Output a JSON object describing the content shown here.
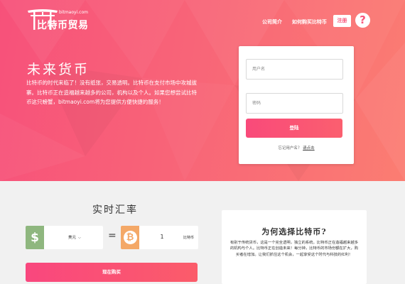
{
  "header": {
    "logo_domain": "bitmaoyi.com",
    "logo_title": "比特币贸易",
    "nav": {
      "about": "公司简介",
      "how_to_buy": "如何购买比特币"
    },
    "register_label": "注册",
    "help_glyph": "?"
  },
  "hero": {
    "heading": "未来货币",
    "text": "比特币的时代来临了！没有纸张，交易透明。比特币在支付市场中攻城拔寨。比特币正在造福越来越多的公司，机构以及个人。如果您想尝试比特币这只螃蟹，bitmaoyi.com将为您提供方便快捷的服务！"
  },
  "login": {
    "username_placeholder": "用户名",
    "password_placeholder": "密码",
    "submit_label": "登陆",
    "forgot_text": "忘记用户名？",
    "forgot_link": "请点击"
  },
  "converter": {
    "title": "实时汇率",
    "usd_glyph": "$",
    "currency_selected": "美元",
    "equals": "=",
    "btc_glyph": "₿",
    "btc_amount": "1",
    "btc_unit": "比特币",
    "buy_label": "现在购买"
  },
  "why": {
    "title": "为何选择比特币?",
    "text": "有别于传统货币，这是一个完全透明，独立的系统。比特币正在造福越来越多的机构与个人。比特币正在创造未来！每分钟，比特币的市场份额在扩大，购买者在增加。让我们抓住这个机会，一起享受这个时代与科技的红利！"
  },
  "colors": {
    "hero_start": "#f7517a",
    "hero_end": "#fb7d72",
    "accent": "#f94a7a",
    "usd": "#8fb77f",
    "btc": "#f4a867"
  }
}
